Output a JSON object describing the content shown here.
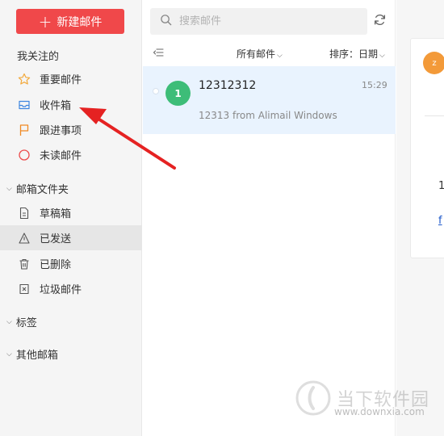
{
  "sidebar": {
    "new_mail_label": "新建邮件",
    "favorites_title": "我关注的",
    "favorites": [
      {
        "label": "重要邮件",
        "icon": "star-icon"
      },
      {
        "label": "收件箱",
        "icon": "inbox-icon"
      },
      {
        "label": "跟进事项",
        "icon": "flag-icon"
      },
      {
        "label": "未读邮件",
        "icon": "circle-icon"
      }
    ],
    "folders_title": "邮箱文件夹",
    "folders": [
      {
        "label": "草稿箱",
        "icon": "draft-icon"
      },
      {
        "label": "已发送",
        "icon": "sent-icon"
      },
      {
        "label": "已删除",
        "icon": "trash-icon"
      },
      {
        "label": "垃圾邮件",
        "icon": "spam-icon"
      }
    ],
    "tags_title": "标签",
    "other_title": "其他邮箱"
  },
  "list": {
    "search_placeholder": "搜索邮件",
    "filter_label": "所有邮件",
    "sort_label": "排序：日期",
    "mails": [
      {
        "avatar": "1",
        "subject": "12312312",
        "time": "15:29",
        "preview": "12313 from Alimail Windows"
      }
    ]
  },
  "reader": {
    "avatar": "z",
    "body_char": "1",
    "link_char": "f"
  },
  "watermark": {
    "title": "当下软件园",
    "url": "www.downxia.com"
  },
  "colors": {
    "accent": "#f0484a",
    "selected_row": "#e9f3fe",
    "avatar_green": "#3dbd78",
    "avatar_orange": "#f39a39",
    "annotation_arrow": "#e52222"
  }
}
